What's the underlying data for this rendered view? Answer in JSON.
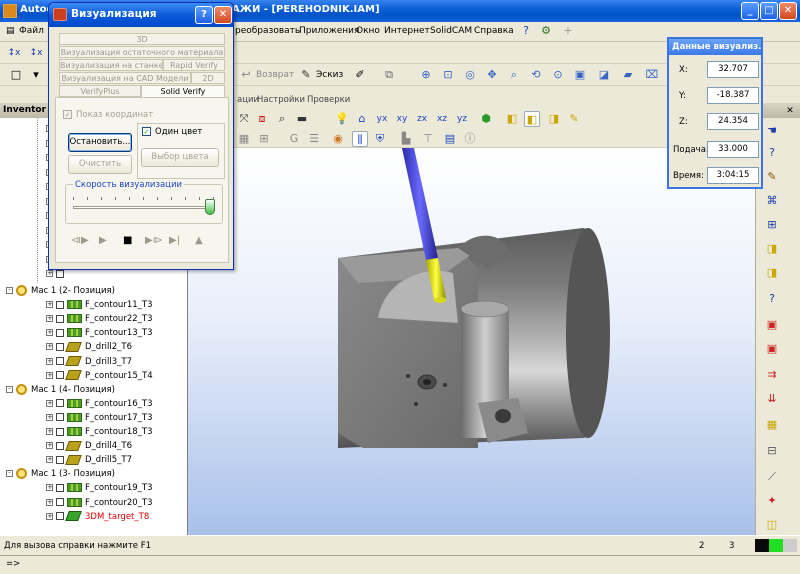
{
  "window": {
    "app_short": "Autodes",
    "title_suffix": "АЖИ - [PEREHODNIK.IAM]"
  },
  "menu": [
    "Файл",
    "реобразовать",
    "Приложения",
    "Окно",
    "Интернет",
    "SolidCAM",
    "Справка"
  ],
  "toolbar2": {
    "back_label": "Возврат",
    "sketch_label": "Эскиз"
  },
  "ribbon_tabs": [
    "ации",
    "Настройки",
    "Проверки"
  ],
  "browser": {
    "header": "Inventor",
    "tree": [
      {
        "label": "Mac 1 (2- Позиция)",
        "kind": "mac"
      },
      {
        "label": "F_contour11_T3",
        "kind": "op"
      },
      {
        "label": "F_contour22_T3",
        "kind": "op"
      },
      {
        "label": "F_contour13_T3",
        "kind": "op"
      },
      {
        "label": "D_drill2_T6",
        "kind": "drill"
      },
      {
        "label": "D_drill3_T7",
        "kind": "drill"
      },
      {
        "label": "P_contour15_T4",
        "kind": "drill"
      },
      {
        "label": "Mac 1 (4- Позиция)",
        "kind": "mac"
      },
      {
        "label": "F_contour16_T3",
        "kind": "op"
      },
      {
        "label": "F_contour17_T3",
        "kind": "op"
      },
      {
        "label": "F_contour18_T3",
        "kind": "op"
      },
      {
        "label": "D_drill4_T6",
        "kind": "drill"
      },
      {
        "label": "D_drill5_T7",
        "kind": "drill"
      },
      {
        "label": "Mac 1 (3- Позиция)",
        "kind": "mac"
      },
      {
        "label": "F_contour19_T3",
        "kind": "op"
      },
      {
        "label": "F_contour20_T3",
        "kind": "op"
      },
      {
        "label": "3DM_target_T8",
        "kind": "target"
      }
    ]
  },
  "viz_dialog": {
    "title": "Визуализация",
    "tabs": {
      "t3d": "3D",
      "residual": "Визуализация остаточного материала",
      "machine": "Визуализация на станке",
      "rapid": "Rapid Verify",
      "cad": "Визуализация на CAD Модели",
      "t2d": "2D",
      "verifyplus": "VerifyPlus",
      "solid": "Solid Verify"
    },
    "show_coords_label": "Показ координат",
    "show_coords_checked": true,
    "one_color_label": "Один цвет",
    "one_color_checked": true,
    "stop_label": "Остановить...",
    "clear_label": "Очистить",
    "choose_color_label": "Выбор цвета",
    "speed_label": "Скорость визуализации",
    "speed_level": 1.0
  },
  "data_window": {
    "title": "Данные визуализ...",
    "x_label": "X:",
    "x_value": "32.707",
    "y_label": "Y:",
    "y_value": "-18.387",
    "z_label": "Z:",
    "z_value": "24.354",
    "feed_label": "Подача:",
    "feed_value": "33.000",
    "time_label": "Время:",
    "time_value": "3:04:15"
  },
  "status": {
    "help_text": "Для вызова справки нажмите F1",
    "num1": "2",
    "num2": "3",
    "cmd_prompt": "=>"
  },
  "colors": {
    "tool_shank": "#4040d8",
    "tool_tip": "#e0e018",
    "part": "#7a7a7a",
    "viewport_bottom": "#a9c1ea"
  }
}
